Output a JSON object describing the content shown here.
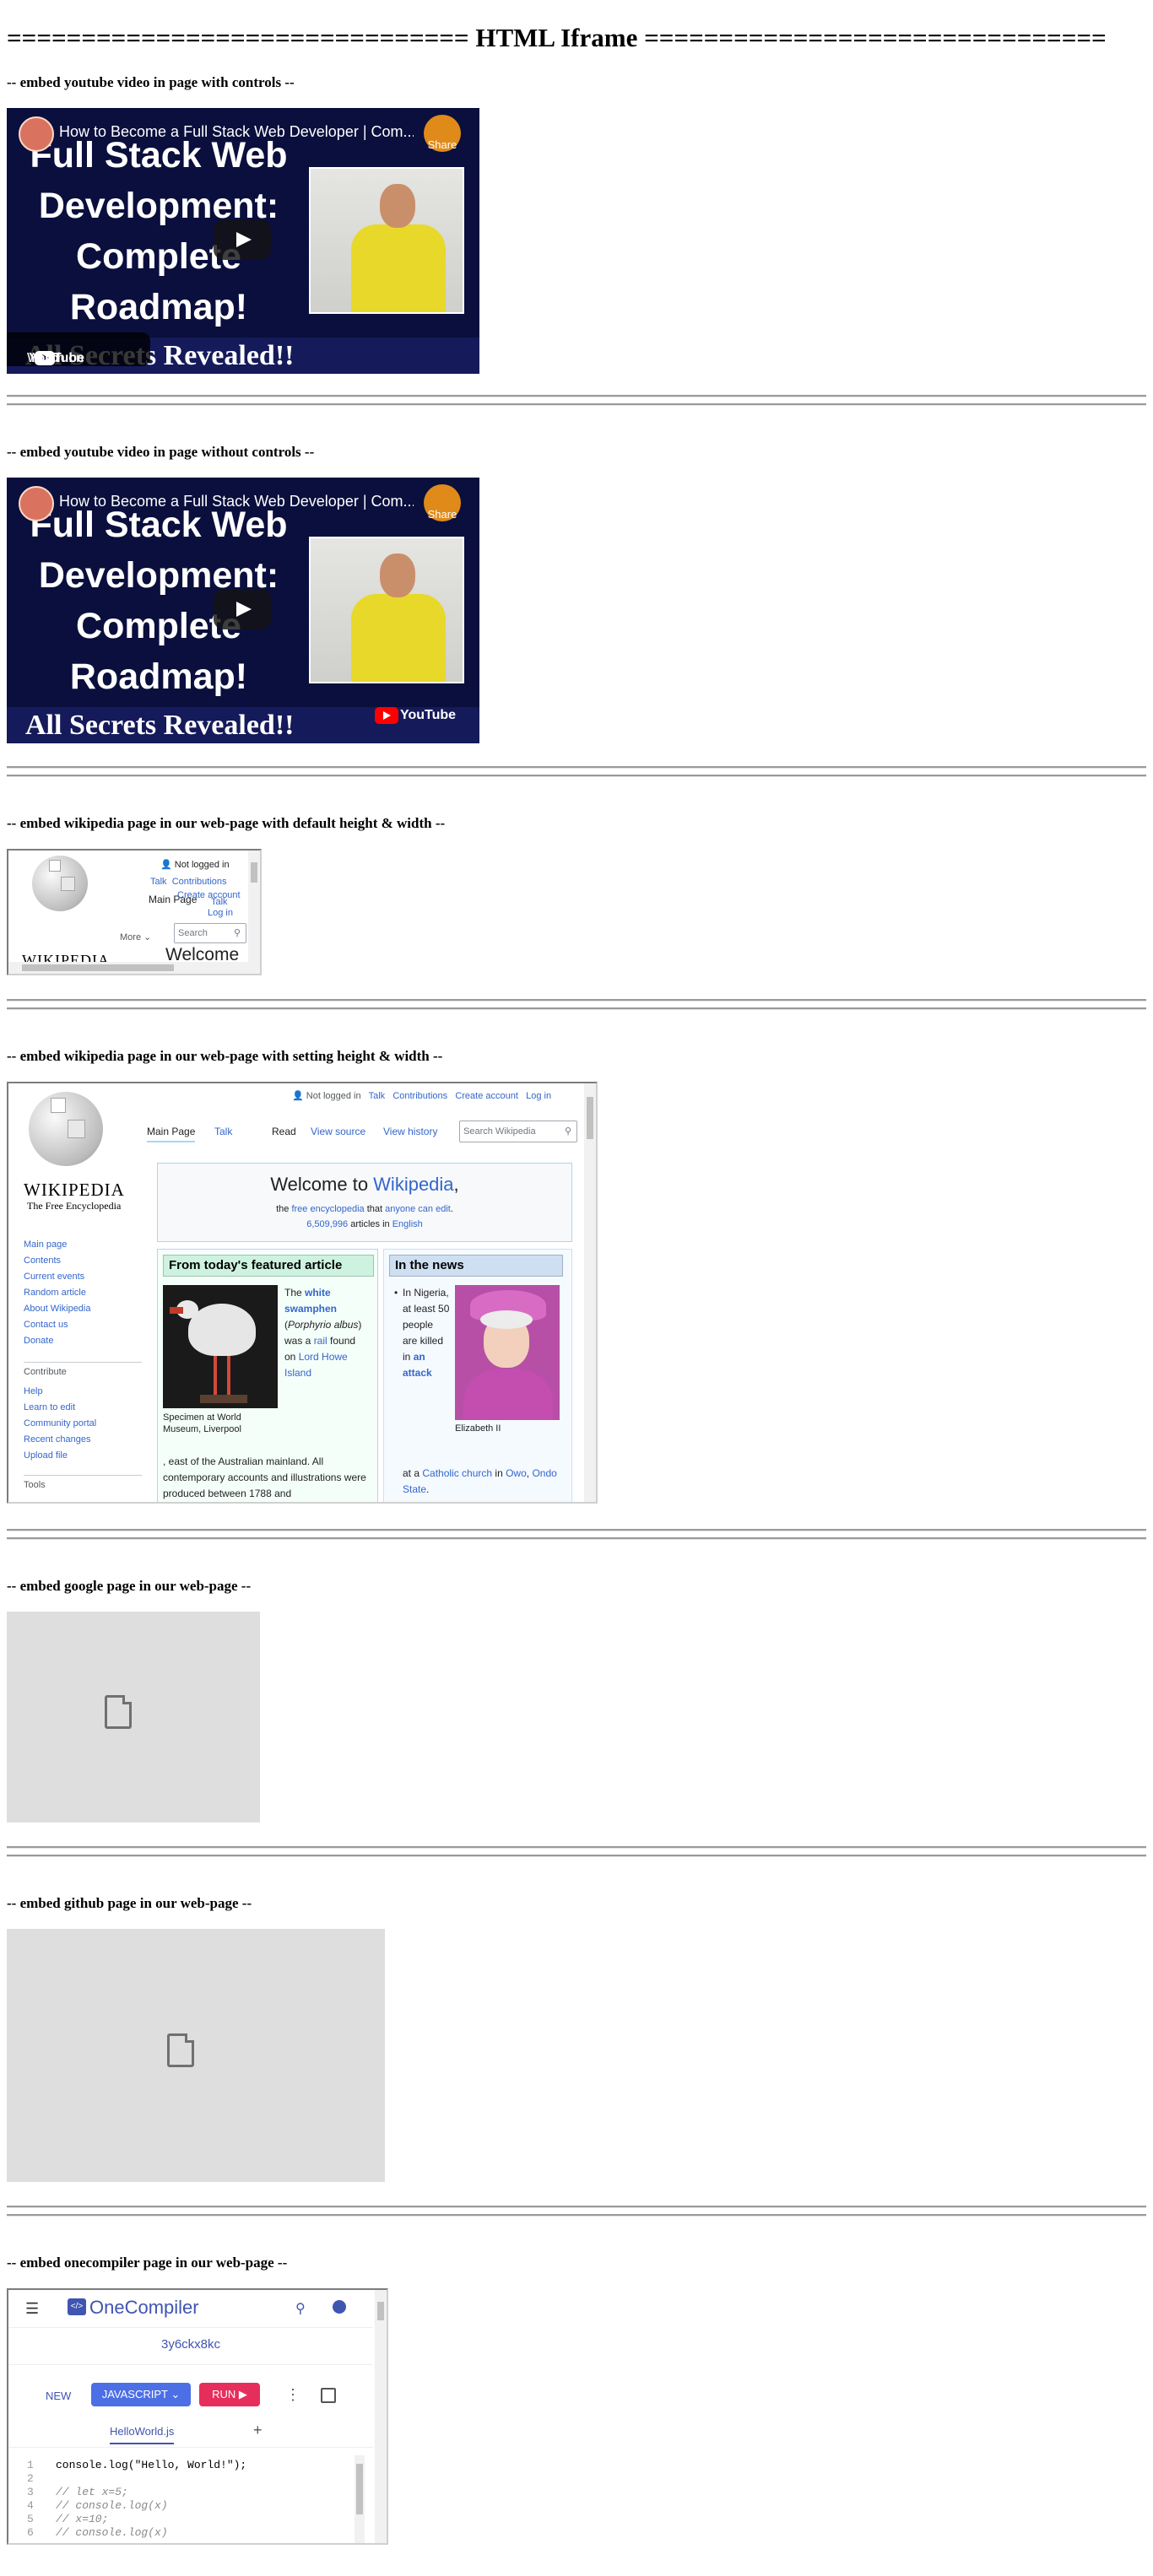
{
  "page": {
    "heading": "=============================== HTML Iframe ==============================="
  },
  "sections": [
    {
      "heading": "-- embed youtube video in page with controls --"
    },
    {
      "heading": "-- embed youtube video in page without controls --"
    },
    {
      "heading": "-- embed wikipedia page in our web-page with default height & width --"
    },
    {
      "heading": "-- embed wikipedia page in our web-page with setting height & width --"
    },
    {
      "heading": "-- embed google page in our web-page --"
    },
    {
      "heading": "-- embed github page in our web-page --"
    },
    {
      "heading": "-- embed onecompiler page in our web-page --"
    }
  ],
  "youtube": {
    "video_title": "How to Become a Full Stack Web Developer | Com...",
    "share_label": "Share",
    "thumb_text_1": "Full Stack Web",
    "thumb_text_2": "Development:",
    "thumb_text_3": "Complete",
    "thumb_text_4": "Roadmap!",
    "thumb_banner": "All Secrets Revealed!!",
    "watch_on": "Watch on",
    "youtube_label": "YouTube"
  },
  "wiki_small": {
    "not_logged_in": "Not logged in",
    "talk": "Talk",
    "contributions": "Contributions",
    "create_account": "Create account",
    "log_in": "Log in",
    "main_page_tab": "Main Page",
    "talk_tab": "Talk",
    "more": "More",
    "search_placeholder": "Search",
    "welcome": "Welcome",
    "wordmark": "WIKIPEDIA"
  },
  "wiki_large": {
    "not_logged_in": "Not logged in",
    "talk": "Talk",
    "contributions": "Contributions",
    "create_account": "Create account",
    "log_in": "Log in",
    "tab_main": "Main Page",
    "tab_talk": "Talk",
    "tab_read": "Read",
    "tab_view_source": "View source",
    "tab_view_history": "View history",
    "search_placeholder": "Search Wikipedia",
    "wordmark": "WIKIPEDIA",
    "tagline": "The Free Encyclopedia",
    "nav": [
      "Main page",
      "Contents",
      "Current events",
      "Random article",
      "About Wikipedia",
      "Contact us",
      "Donate"
    ],
    "contribute_heading": "Contribute",
    "contribute": [
      "Help",
      "Learn to edit",
      "Community portal",
      "Recent changes",
      "Upload file"
    ],
    "tools_heading": "Tools",
    "welcome_prefix": "Welcome to ",
    "welcome_link": "Wikipedia",
    "welcome_suffix": ",",
    "the": "the ",
    "free_encyclopedia": "free encyclopedia",
    "that": " that ",
    "anyone_can_edit": "anyone can edit",
    "period": ".",
    "article_count": "6,509,996",
    "articles_in": " articles in ",
    "english": "English",
    "featured_heading": "From today's featured article",
    "featured_caption": "Specimen at World Museum, Liverpool",
    "featured_the": "The ",
    "featured_link1": "white swamphen",
    "featured_paren_open": " (",
    "featured_sci": "Porphyrio albus",
    "featured_mid": ") was a ",
    "featured_rail": "rail",
    "featured_found": " found on ",
    "featured_island": "Lord Howe Island",
    "featured_rest": ", east of the Australian mainland. All contemporary accounts and illustrations were produced between 1788 and",
    "news_heading": "In the news",
    "news_caption": "Elizabeth II",
    "news_text1": "In Nigeria, at least 50 people are killed in ",
    "news_link1": "an attack",
    "news_text2": " at a ",
    "news_link2": "Catholic church",
    "news_text3": " in ",
    "news_link3": "Owo",
    "news_text4": ", ",
    "news_link4": "Ondo State",
    "news_text5": "."
  },
  "onecompiler": {
    "brand": "OneCompiler",
    "logo_glyph": "</>",
    "code_id": "3y6ckx8kc",
    "new_label": "NEW",
    "language_label": "JAVASCRIPT",
    "run_label": "RUN",
    "file_tab": "HelloWorld.js",
    "add_tab": "+",
    "lines": [
      {
        "n": "1",
        "code": "console.log(\"Hello, World!\");"
      },
      {
        "n": "2",
        "code": ""
      },
      {
        "n": "3",
        "code": "// let x=5;"
      },
      {
        "n": "4",
        "code": "// console.log(x)"
      },
      {
        "n": "5",
        "code": "// x=10;"
      },
      {
        "n": "6",
        "code": "// console.log(x)"
      }
    ]
  },
  "colors": {
    "link": "#3366cc",
    "oc_brand": "#4054b2",
    "oc_language_btn": "#4c6fe6",
    "oc_run_btn": "#e62e5c",
    "yt_bg": "#0a0f3d"
  }
}
